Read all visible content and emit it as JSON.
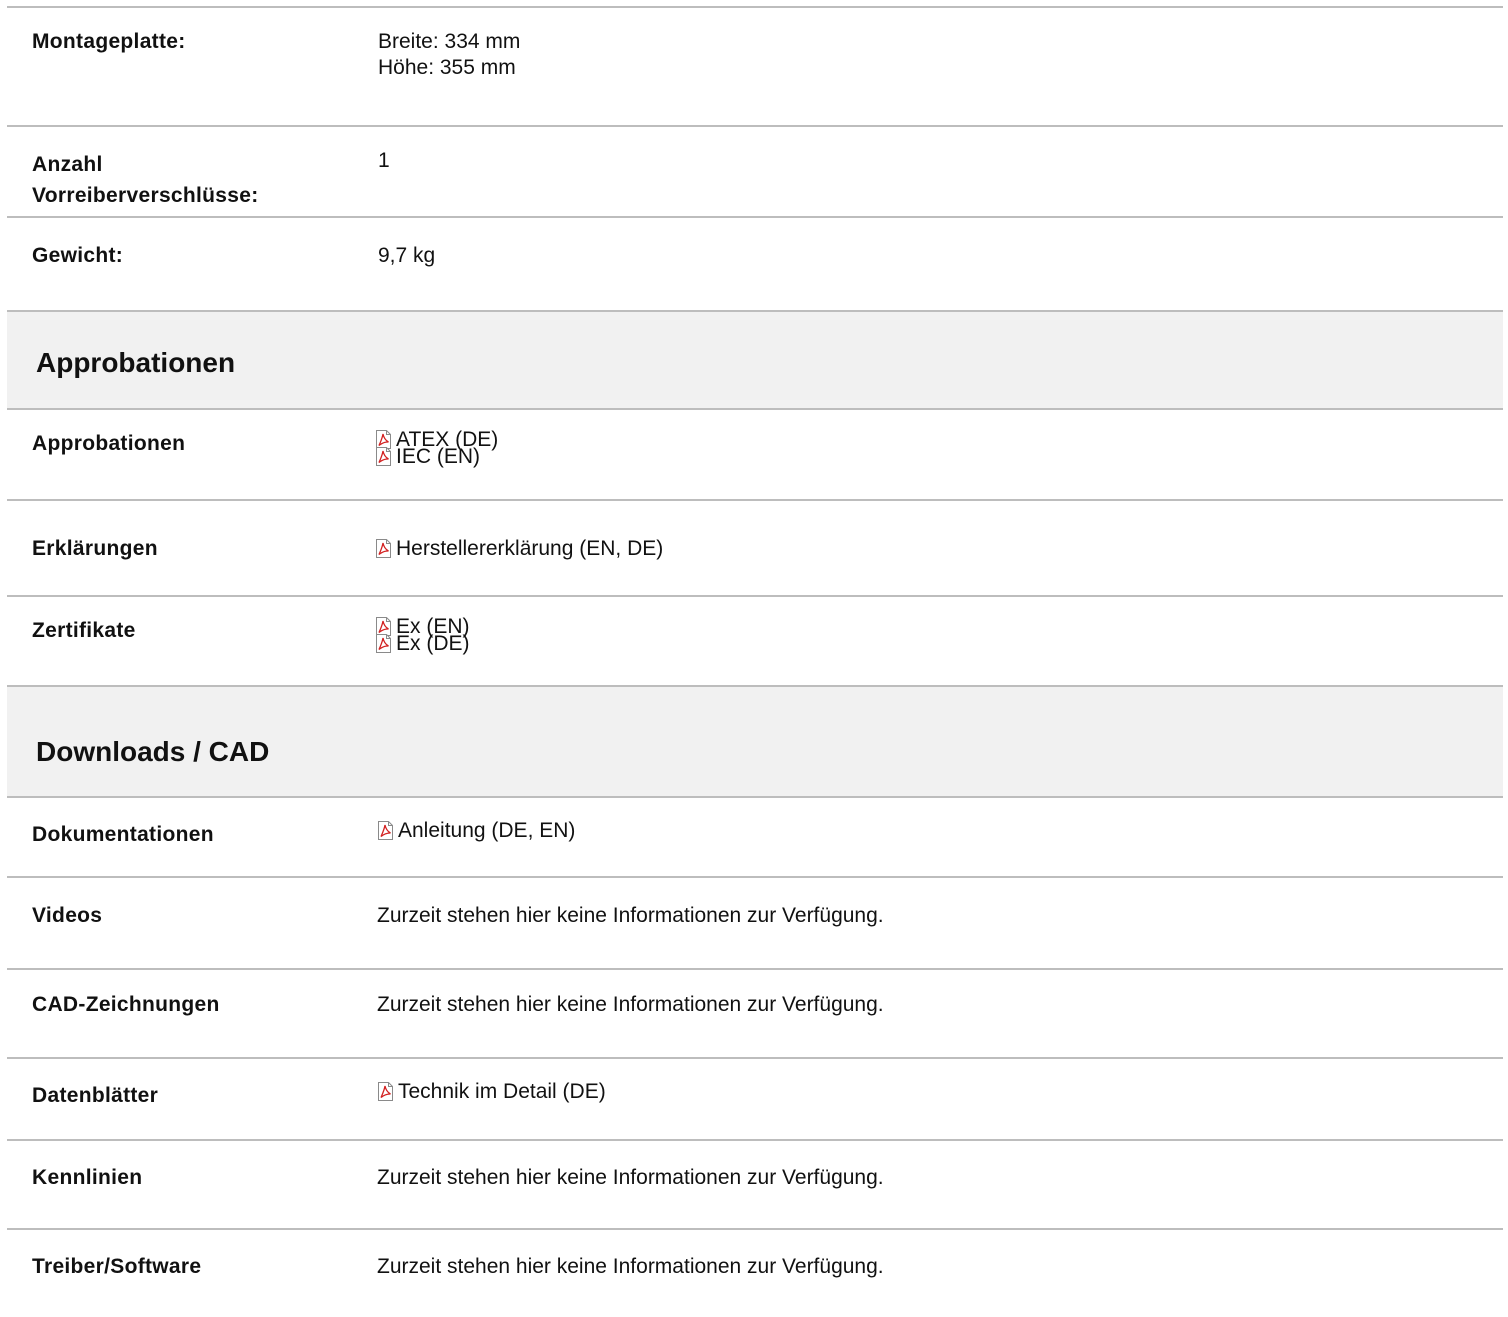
{
  "colors": {
    "divider": "#bdbdbd",
    "section_band": "#f1f1f1",
    "pdf_icon": "#d22020"
  },
  "specs": [
    {
      "label": "Montageplatte:",
      "values": [
        "Breite: 334 mm",
        "Höhe: 355 mm"
      ]
    },
    {
      "label": "Anzahl Vorreiberverschlüsse:",
      "label_lines": [
        "Anzahl",
        "Vorreiberverschlüsse:"
      ],
      "values": [
        "1"
      ]
    },
    {
      "label": "Gewicht:",
      "values": [
        "9,7 kg"
      ]
    }
  ],
  "approbationen": {
    "title": "Approbationen",
    "rows": [
      {
        "label": "Approbationen",
        "links": [
          "ATEX (DE)",
          "IEC (EN)"
        ],
        "icon": "pdf-icon"
      },
      {
        "label": "Erklärungen",
        "links": [
          "Herstellererklärung (EN, DE)"
        ],
        "icon": "pdf-icon"
      },
      {
        "label": "Zertifikate",
        "links": [
          "Ex (EN)",
          "Ex (DE)"
        ],
        "icon": "pdf-icon"
      }
    ]
  },
  "downloads": {
    "title": "Downloads / CAD",
    "rows": [
      {
        "label": "Dokumentationen",
        "links": [
          "Anleitung (DE, EN)"
        ],
        "icon": "pdf-icon"
      },
      {
        "label": "Videos",
        "text": "Zurzeit stehen hier keine Informationen zur Verfügung."
      },
      {
        "label": "CAD-Zeichnungen",
        "text": "Zurzeit stehen hier keine Informationen zur Verfügung."
      },
      {
        "label": "Datenblätter",
        "links": [
          "Technik im Detail (DE)"
        ],
        "icon": "pdf-icon"
      },
      {
        "label": "Kennlinien",
        "text": "Zurzeit stehen hier keine Informationen zur Verfügung."
      },
      {
        "label": "Treiber/Software",
        "text": "Zurzeit stehen hier keine Informationen zur Verfügung."
      }
    ]
  }
}
